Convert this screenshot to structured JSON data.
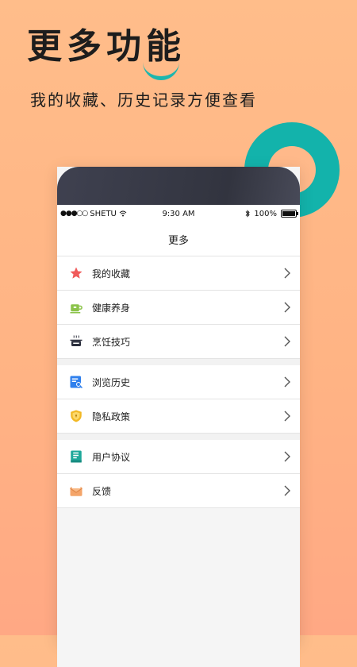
{
  "hero": {
    "title": "更多功能",
    "subtitle": "我的收藏、历史记录方便查看"
  },
  "statusbar": {
    "carrier": "SHETU",
    "time": "9:30 AM",
    "battery": "100%"
  },
  "navbar": {
    "title": "更多"
  },
  "menu": {
    "group1": [
      {
        "label": "我的收藏",
        "icon": "star-icon"
      },
      {
        "label": "健康养身",
        "icon": "tea-cup-icon"
      },
      {
        "label": "烹饪技巧",
        "icon": "cooking-pot-icon"
      }
    ],
    "group2": [
      {
        "label": "浏览历史",
        "icon": "history-search-icon"
      },
      {
        "label": "隐私政策",
        "icon": "shield-icon"
      }
    ],
    "group3": [
      {
        "label": "用户协议",
        "icon": "document-icon"
      },
      {
        "label": "反馈",
        "icon": "mail-icon"
      }
    ]
  },
  "colors": {
    "accent": "#13b3ab",
    "background": "#ffb98a"
  }
}
